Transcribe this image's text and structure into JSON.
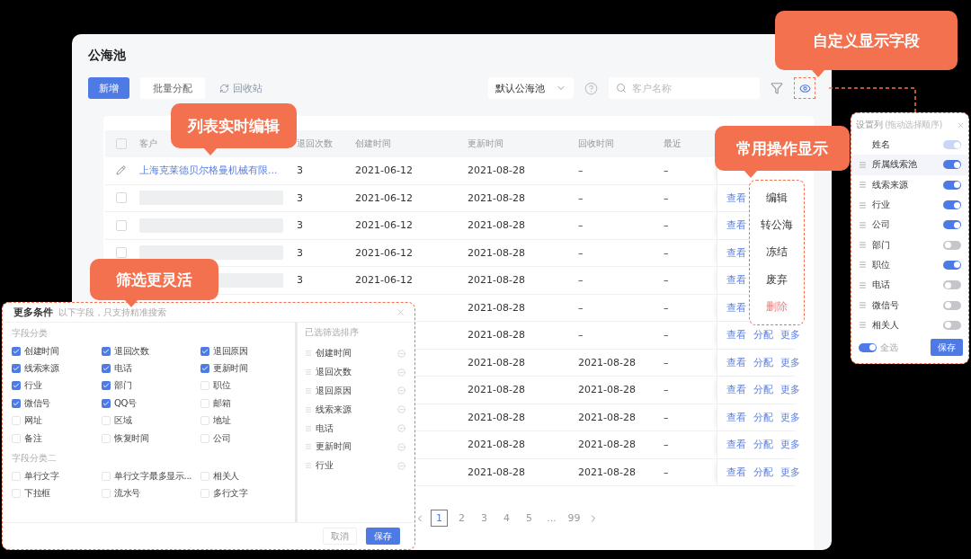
{
  "window": {
    "title": "公海池"
  },
  "toolbar": {
    "buttons": [
      {
        "label": "新增",
        "kind": "primary"
      },
      {
        "label": "批量分配",
        "kind": "plain"
      },
      {
        "label": "回收站",
        "kind": "link"
      }
    ],
    "pool_select": {
      "value": "默认公海池"
    },
    "search": {
      "placeholder": "客户名称"
    }
  },
  "table": {
    "columns": [
      "客户",
      "退回次数",
      "创建时间",
      "更新时间",
      "回收时间",
      "最近"
    ],
    "header_checked": false,
    "rows": [
      {
        "kind": "editing",
        "name": "上海克莱德贝尔格曼机械有限...",
        "count": "3",
        "created": "2021-06-12",
        "updated": "2021-08-28",
        "recycled": "–",
        "latest": "–"
      },
      {
        "kind": "redacted",
        "checked": false,
        "count": "3",
        "created": "2021-06-12",
        "updated": "2021-08-28",
        "recycled": "–",
        "latest": "–",
        "actions": [
          "查看"
        ]
      },
      {
        "kind": "redacted",
        "checked": false,
        "count": "3",
        "created": "2021-06-12",
        "updated": "2021-08-28",
        "recycled": "–",
        "latest": "–",
        "actions": [
          "查看"
        ]
      },
      {
        "kind": "redacted",
        "checked": false,
        "count": "3",
        "created": "2021-06-12",
        "updated": "2021-08-28",
        "recycled": "–",
        "latest": "–",
        "actions": [
          "查看"
        ]
      },
      {
        "kind": "redacted",
        "count": "3",
        "created": "2021-06-12",
        "updated": "2021-08-28",
        "recycled": "–",
        "latest": "–",
        "actions": [
          "查看"
        ]
      },
      {
        "kind": "covered",
        "updated": "2021-08-28",
        "recycled": "–",
        "latest": "–",
        "actions": [
          "查看"
        ]
      },
      {
        "kind": "covered",
        "updated": "2021-08-28",
        "recycled": "–",
        "latest": "–",
        "actions": [
          "查看",
          "分配",
          "更多"
        ]
      },
      {
        "kind": "covered",
        "updated": "2021-08-28",
        "recycled": "2021-08-28",
        "latest": "–",
        "actions": [
          "查看",
          "分配",
          "更多"
        ]
      },
      {
        "kind": "covered",
        "updated": "2021-08-28",
        "recycled": "2021-08-28",
        "latest": "–",
        "actions": [
          "查看",
          "分配",
          "更多"
        ]
      },
      {
        "kind": "covered",
        "updated": "2021-08-28",
        "recycled": "2021-08-28",
        "latest": "–",
        "actions": [
          "查看",
          "分配",
          "更多"
        ]
      },
      {
        "kind": "covered",
        "updated": "2021-08-28",
        "recycled": "2021-08-28",
        "latest": "–",
        "actions": [
          "查看",
          "分配",
          "更多"
        ]
      },
      {
        "kind": "covered",
        "updated": "2021-08-28",
        "recycled": "2021-08-28",
        "latest": "–",
        "actions": [
          "查看",
          "分配",
          "更多"
        ]
      }
    ]
  },
  "pagination": {
    "pages": [
      {
        "label": "1",
        "selected": true
      },
      {
        "label": "2",
        "selected": false
      },
      {
        "label": "3",
        "selected": false
      },
      {
        "label": "4",
        "selected": false
      },
      {
        "label": "5",
        "selected": false
      },
      {
        "label": "...",
        "selected": false
      },
      {
        "label": "99",
        "selected": false
      }
    ]
  },
  "action_menu": {
    "items": [
      {
        "label": "编辑",
        "danger": false
      },
      {
        "label": "转公海",
        "danger": false
      },
      {
        "label": "冻结",
        "danger": false
      },
      {
        "label": "废弃",
        "danger": false
      },
      {
        "label": "删除",
        "danger": true
      }
    ]
  },
  "column_settings": {
    "title": "设置列",
    "hint": "(拖动选择顺序)",
    "items": [
      {
        "label": "姓名",
        "on": true,
        "disabled": true,
        "selected": false
      },
      {
        "label": "所属线索池",
        "on": true,
        "disabled": false,
        "selected": true
      },
      {
        "label": "线索来源",
        "on": true,
        "disabled": false,
        "selected": false
      },
      {
        "label": "行业",
        "on": true,
        "disabled": false,
        "selected": false
      },
      {
        "label": "公司",
        "on": true,
        "disabled": false,
        "selected": false
      },
      {
        "label": "部门",
        "on": false,
        "disabled": false,
        "selected": false
      },
      {
        "label": "职位",
        "on": true,
        "disabled": false,
        "selected": false
      },
      {
        "label": "电话",
        "on": false,
        "disabled": false,
        "selected": false
      },
      {
        "label": "微信号",
        "on": false,
        "disabled": false,
        "selected": false
      },
      {
        "label": "相关人",
        "on": false,
        "disabled": false,
        "selected": false
      }
    ],
    "select_all": {
      "label": "全选",
      "on": true
    },
    "save": "保存"
  },
  "filter": {
    "title": "更多条件",
    "hint": "以下字段，只支持精准搜索",
    "groups": [
      {
        "title": "字段分类",
        "options": [
          {
            "label": "创建时间",
            "checked": true
          },
          {
            "label": "退回次数",
            "checked": true
          },
          {
            "label": "退回原因",
            "checked": true
          },
          {
            "label": "线索来源",
            "checked": true
          },
          {
            "label": "电话",
            "checked": true
          },
          {
            "label": "更新时间",
            "checked": true
          },
          {
            "label": "行业",
            "checked": true
          },
          {
            "label": "部门",
            "checked": true
          },
          {
            "label": "职位",
            "checked": false
          },
          {
            "label": "微信号",
            "checked": true
          },
          {
            "label": "QQ号",
            "checked": true
          },
          {
            "label": "邮箱",
            "checked": false
          },
          {
            "label": "网址",
            "checked": false
          },
          {
            "label": "区域",
            "checked": false
          },
          {
            "label": "地址",
            "checked": false
          },
          {
            "label": "备注",
            "checked": false
          },
          {
            "label": "恢复时间",
            "checked": false
          },
          {
            "label": "公司",
            "checked": false
          }
        ]
      },
      {
        "title": "字段分类二",
        "options": [
          {
            "label": "单行文字",
            "checked": false
          },
          {
            "label": "单行文字最多显示...",
            "checked": false
          },
          {
            "label": "相关人",
            "checked": false
          },
          {
            "label": "下拉框",
            "checked": false
          },
          {
            "label": "流水号",
            "checked": false
          },
          {
            "label": "多行文字",
            "checked": false
          }
        ]
      }
    ],
    "sorted": {
      "title": "已选筛选排序",
      "items": [
        "创建时间",
        "退回次数",
        "退回原因",
        "线索来源",
        "电话",
        "更新时间",
        "行业"
      ]
    },
    "buttons": [
      {
        "label": "取消",
        "kind": "plain"
      },
      {
        "label": "保存",
        "kind": "primary"
      }
    ]
  },
  "callouts": [
    {
      "text": "列表实时编辑"
    },
    {
      "text": "筛选更灵活"
    },
    {
      "text": "常用操作显示"
    },
    {
      "text": "自定义显示字段"
    }
  ]
}
